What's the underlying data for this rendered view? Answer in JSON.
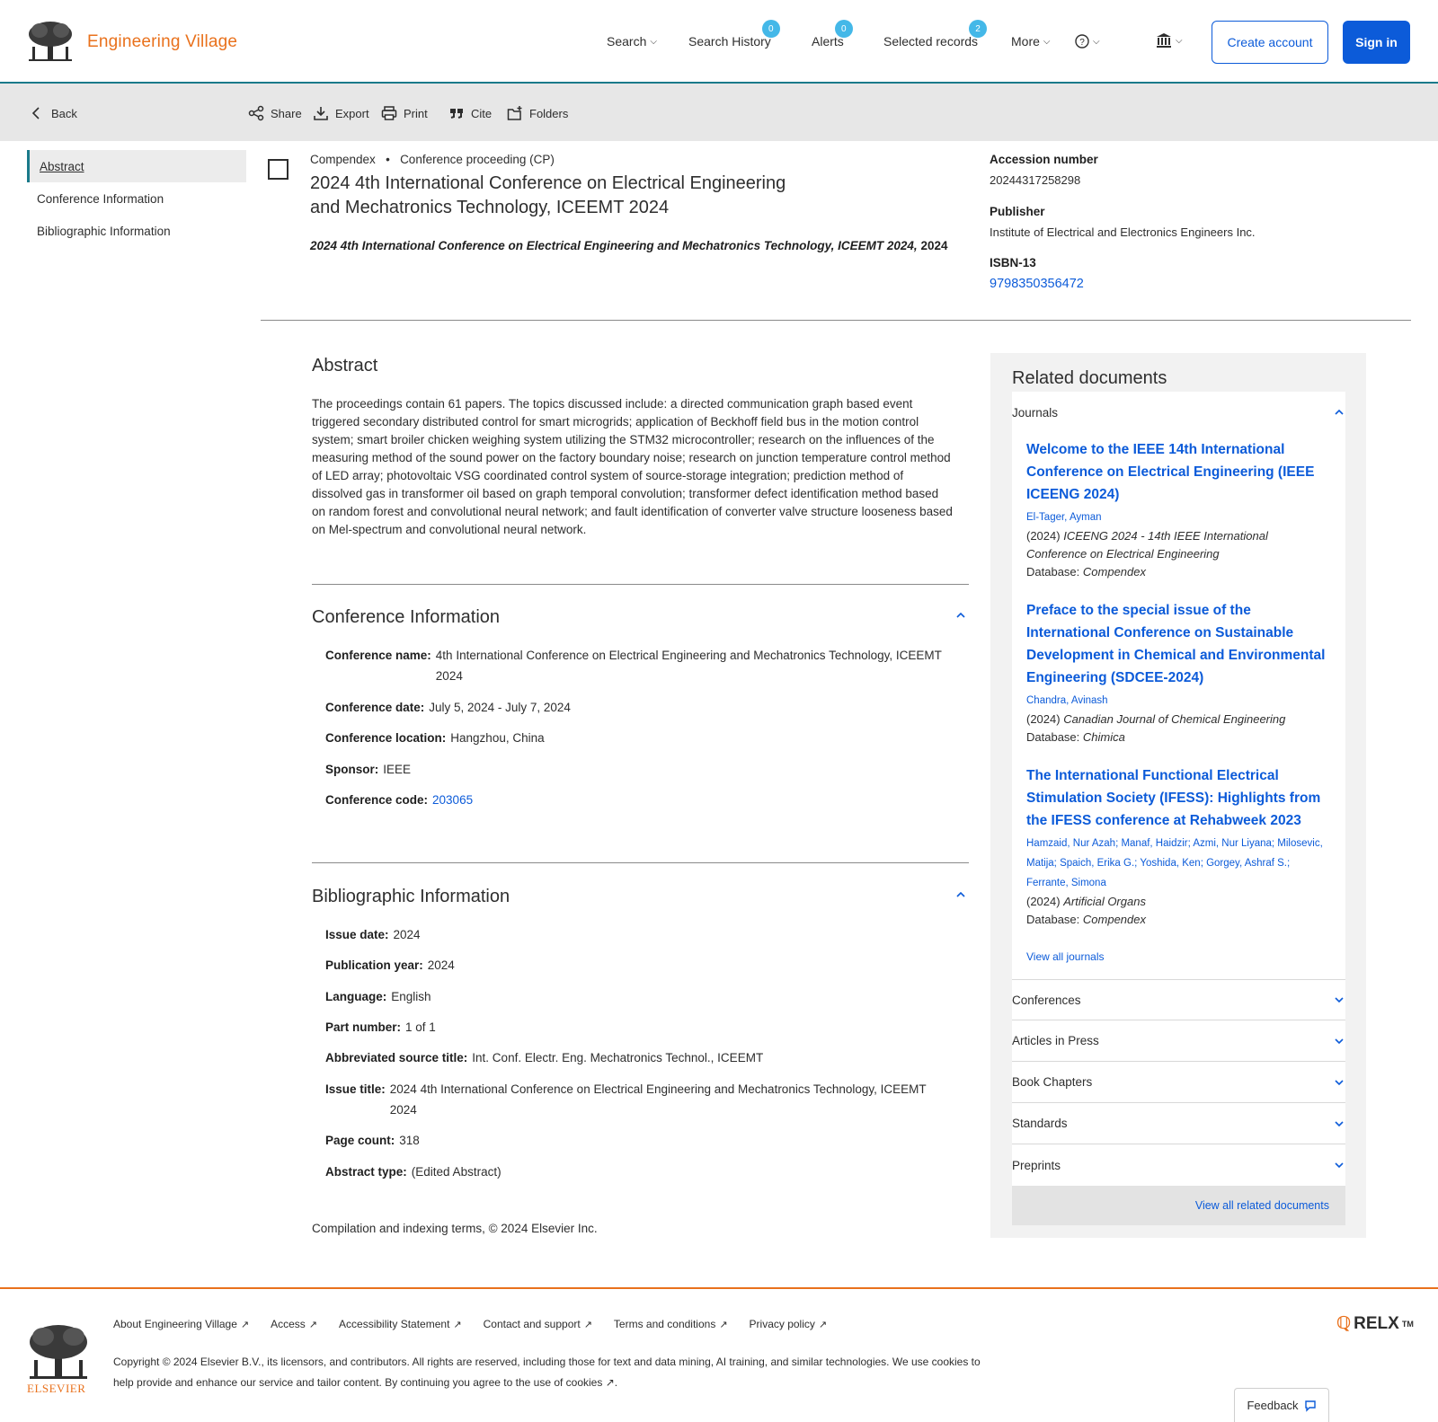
{
  "brand": {
    "name": "Engineering Village"
  },
  "nav": {
    "search": "Search",
    "search_history": "Search History",
    "search_history_count": "0",
    "alerts": "Alerts",
    "alerts_count": "0",
    "selected_records": "Selected records",
    "selected_records_count": "2",
    "more": "More",
    "create_account": "Create account",
    "sign_in": "Sign in"
  },
  "toolbar": {
    "back": "Back",
    "share": "Share",
    "export": "Export",
    "print": "Print",
    "cite": "Cite",
    "folders": "Folders"
  },
  "leftnav": {
    "items": [
      "Abstract",
      "Conference Information",
      "Bibliographic Information"
    ]
  },
  "record": {
    "database": "Compendex",
    "doc_type": "Conference proceeding (CP)",
    "title": "2024 4th International Conference on Electrical Engineering and Mechatronics Technology, ICEEMT 2024",
    "source": "2024 4th International Conference on Electrical Engineering and Mechatronics Technology, ICEEMT 2024,",
    "source_year": "2024"
  },
  "side_meta": {
    "accession_label": "Accession number",
    "accession_value": "20244317258298",
    "publisher_label": "Publisher",
    "publisher_value": "Institute of Electrical and Electronics Engineers Inc.",
    "isbn_label": "ISBN-13",
    "isbn_value": "9798350356472"
  },
  "abstract": {
    "heading": "Abstract",
    "text": "The proceedings contain 61 papers. The topics discussed include: a directed communication graph based event triggered secondary distributed control for smart microgrids; application of Beckhoff field bus in the motion control system; smart broiler chicken weighing system utilizing the STM32 microcontroller; research on the influences of the measuring method of the sound power on the factory boundary noise; research on junction temperature control method of LED array; photovoltaic VSG coordinated control system of source-storage integration; prediction method of dissolved gas in transformer oil based on graph temporal convolution; transformer defect identification method based on random forest and convolutional neural network; and fault identification of converter valve structure looseness based on Mel-spectrum and convolutional neural network."
  },
  "conference": {
    "heading": "Conference Information",
    "name_label": "Conference name:",
    "name_value": "4th International Conference on Electrical Engineering and Mechatronics Technology, ICEEMT 2024",
    "date_label": "Conference date:",
    "date_value": "July 5, 2024 - July 7, 2024",
    "location_label": "Conference location:",
    "location_value": "Hangzhou, China",
    "sponsor_label": "Sponsor:",
    "sponsor_value": "IEEE",
    "code_label": "Conference code:",
    "code_value": "203065"
  },
  "biblio": {
    "heading": "Bibliographic Information",
    "issue_date_label": "Issue date:",
    "issue_date_value": "2024",
    "pub_year_label": "Publication year:",
    "pub_year_value": "2024",
    "language_label": "Language:",
    "language_value": "English",
    "part_label": "Part number:",
    "part_value": "1 of 1",
    "abbr_label": "Abbreviated source title:",
    "abbr_value": "Int. Conf. Electr. Eng. Mechatronics Technol., ICEEMT",
    "issue_title_label": "Issue title:",
    "issue_title_value": "2024 4th International Conference on Electrical Engineering and Mechatronics Technology, ICEEMT 2024",
    "page_count_label": "Page count:",
    "page_count_value": "318",
    "abstract_type_label": "Abstract type:",
    "abstract_type_value": "(Edited Abstract)"
  },
  "compilation": "Compilation and indexing terms, © 2024 Elsevier Inc.",
  "related": {
    "heading": "Related documents",
    "journals_label": "Journals",
    "docs": [
      {
        "title": "Welcome to the IEEE 14th International Conference on Electrical Engineering (IEEE ICEENG 2024)",
        "authors": "El-Tager, Ayman",
        "year": "(2024)",
        "source": "ICEENG 2024 - 14th IEEE International Conference on Electrical Engineering",
        "db_label": "Database:",
        "db": "Compendex"
      },
      {
        "title": "Preface to the special issue of the International Conference on Sustainable Development in Chemical and Environmental Engineering (SDCEE-2024)",
        "authors": "Chandra, Avinash",
        "year": "(2024)",
        "source": "Canadian Journal of Chemical Engineering",
        "db_label": "Database:",
        "db": "Chimica"
      },
      {
        "title": "The International Functional Electrical Stimulation Society (IFESS): Highlights from the IFESS conference at Rehabweek 2023",
        "authors": "Hamzaid, Nur Azah; Manaf, Haidzir; Azmi, Nur Liyana; Milosevic, Matija; Spaich, Erika G.; Yoshida, Ken; Gorgey, Ashraf S.; Ferrante, Simona",
        "year": "(2024)",
        "source": "Artificial Organs",
        "db_label": "Database:",
        "db": "Compendex"
      }
    ],
    "view_all_journals": "View all journals",
    "sections": [
      "Conferences",
      "Articles in Press",
      "Book Chapters",
      "Standards",
      "Preprints"
    ],
    "view_all_related": "View all related documents"
  },
  "footer": {
    "elsevier": "ELSEVIER",
    "links": [
      "About Engineering Village",
      "Access",
      "Accessibility Statement",
      "Contact and support",
      "Terms and conditions",
      "Privacy policy"
    ],
    "copyright": "Copyright © 2024 Elsevier B.V., its licensors, and contributors. All rights are reserved, including those for text and data mining, AI training, and similar technologies. We use cookies to help provide and enhance our service and tailor content. By continuing you agree to the use of cookies",
    "relx": "RELX",
    "relx_tm": "TM",
    "feedback": "Feedback"
  },
  "colors": {
    "brand_orange": "#e9711c",
    "link_blue": "#0c5bd9",
    "badge_blue": "#44b8e8",
    "teal_rule": "#1a7a8a"
  }
}
